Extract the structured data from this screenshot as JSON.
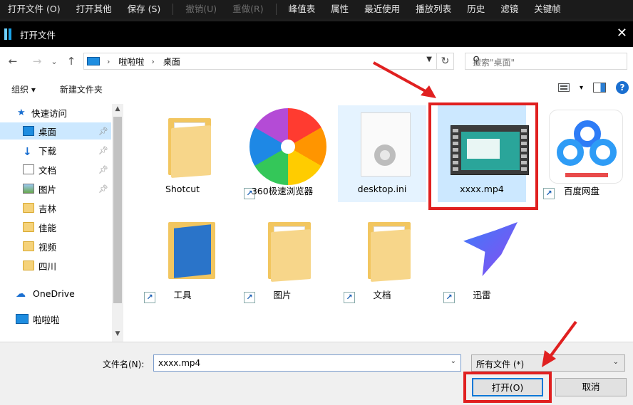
{
  "appbar": {
    "items": [
      "打开文件 (O)",
      "打开其他",
      "保存 (S)",
      "撤销(U)",
      "重做(R)",
      "峰值表",
      "属性",
      "最近使用",
      "播放列表",
      "历史",
      "滤镜",
      "关键帧"
    ]
  },
  "dialog": {
    "title": "打开文件",
    "close": "✕"
  },
  "nav": {
    "back": "←",
    "forward": "→",
    "recent": "⌄",
    "up": "↑",
    "breadcrumb": [
      "啦啦啦",
      "桌面"
    ],
    "search_placeholder": "搜索\"桌面\""
  },
  "toolbar": {
    "organize": "组织 ▾",
    "new_folder": "新建文件夹",
    "view_dd": "▾",
    "help": "?"
  },
  "sidebar": {
    "quick_access": "快速访问",
    "items": [
      {
        "label": "桌面",
        "pinned": true
      },
      {
        "label": "下载",
        "pinned": true
      },
      {
        "label": "文档",
        "pinned": true
      },
      {
        "label": "图片",
        "pinned": true
      },
      {
        "label": "吉林",
        "pinned": false
      },
      {
        "label": "佳能",
        "pinned": false
      },
      {
        "label": "视频",
        "pinned": false
      },
      {
        "label": "四川",
        "pinned": false
      }
    ],
    "onedrive": "OneDrive",
    "pc": "啦啦啦"
  },
  "files": [
    {
      "label": "Shotcut",
      "kind": "folder"
    },
    {
      "label": "360极速浏览器",
      "kind": "app"
    },
    {
      "label": "desktop.ini",
      "kind": "ini"
    },
    {
      "label": "xxxx.mp4",
      "kind": "video"
    },
    {
      "label": "百度网盘",
      "kind": "app"
    },
    {
      "label": "工具",
      "kind": "folder"
    },
    {
      "label": "图片",
      "kind": "folder"
    },
    {
      "label": "文档",
      "kind": "folder"
    },
    {
      "label": "迅雷",
      "kind": "app"
    }
  ],
  "bottom": {
    "filename_label": "文件名(N):",
    "filename_value": "xxxx.mp4",
    "filetype_value": "所有文件  (*)",
    "open_button": "打开(O)",
    "cancel_button": "取消"
  },
  "colors": {
    "highlight_red": "#e02020",
    "selection_blue": "#cce8ff",
    "accent": "#0078d7"
  }
}
